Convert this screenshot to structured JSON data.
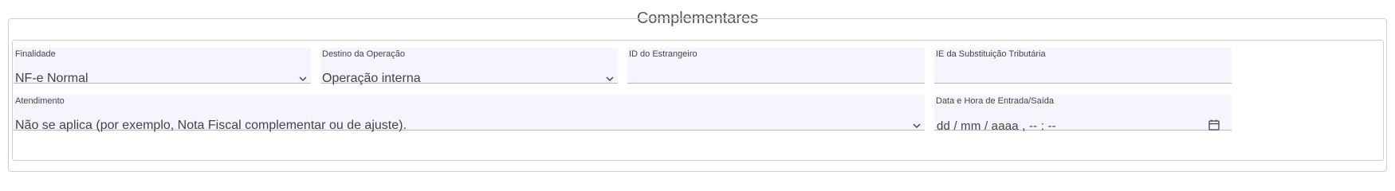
{
  "section": {
    "title": "Complementares"
  },
  "fields": {
    "finalidade": {
      "label": "Finalidade",
      "value": "NF-e Normal"
    },
    "destino": {
      "label": "Destino da Operação",
      "value": "Operação interna"
    },
    "id_estrangeiro": {
      "label": "ID do Estrangeiro",
      "value": ""
    },
    "ie_st": {
      "label": "IE da Substituição Tributária",
      "value": ""
    },
    "atendimento": {
      "label": "Atendimento",
      "value": "Não se aplica (por exemplo, Nota Fiscal complementar ou de ajuste)."
    },
    "data_hora": {
      "label": "Data e Hora de Entrada/Saída",
      "placeholder": "dd / mm / aaaa ,  -- : --"
    }
  },
  "icons": {
    "select": "chevron-down-icon",
    "date": "calendar-icon"
  }
}
